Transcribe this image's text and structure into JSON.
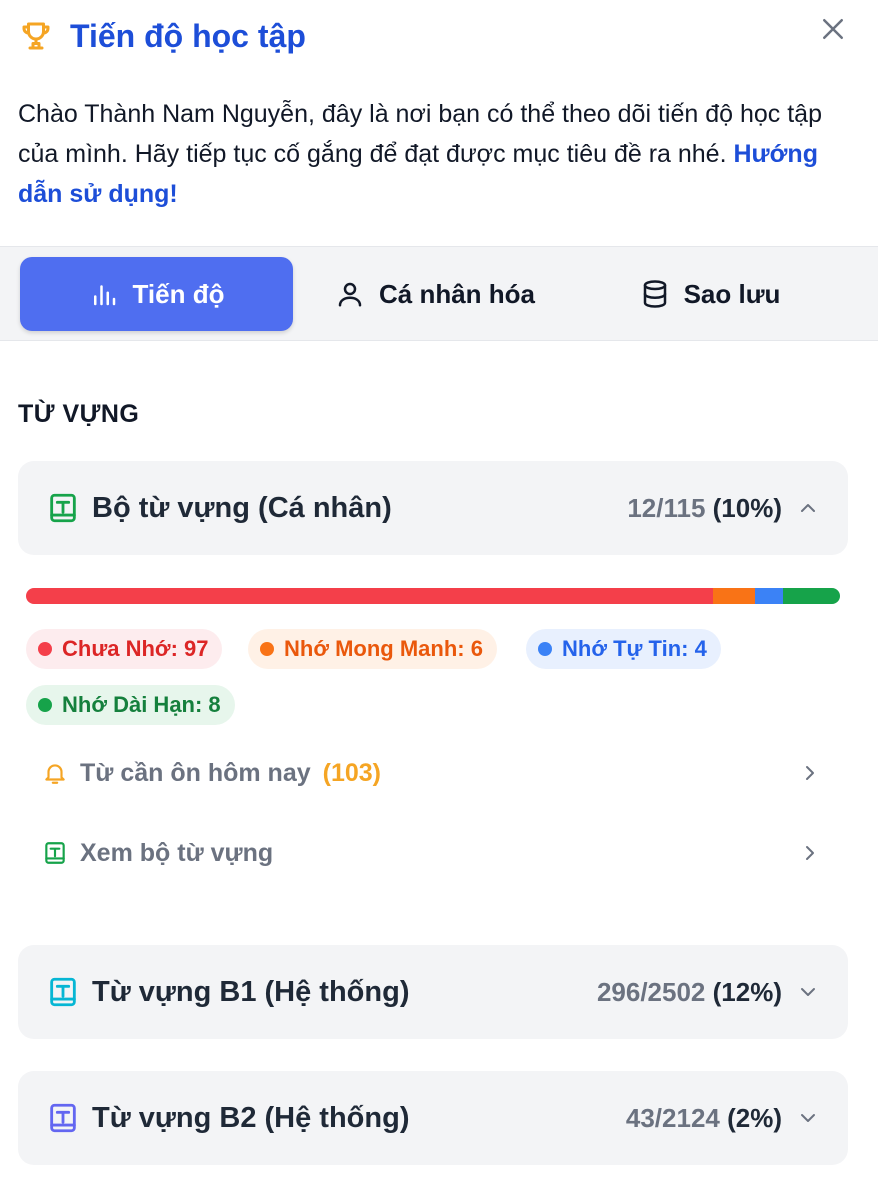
{
  "header": {
    "title": "Tiến độ học tập",
    "intro": "Chào Thành Nam Nguyễn, đây là nơi bạn có thể theo dõi tiến độ học tập của mình. Hãy tiếp tục cố gắng để đạt được mục tiêu đề ra nhé.",
    "guide_link": "Hướng dẫn sử dụng!"
  },
  "tabs": [
    {
      "label": "Tiến độ",
      "icon": "bar-chart-icon",
      "active": true
    },
    {
      "label": "Cá nhân hóa",
      "icon": "user-icon",
      "active": false
    },
    {
      "label": "Sao lưu",
      "icon": "database-icon",
      "active": false
    }
  ],
  "section_label": "TỪ VỰNG",
  "decks": [
    {
      "name": "Bộ từ vựng (Cá nhân)",
      "count": "12/115",
      "percent": "(10%)",
      "expanded": true,
      "icon_color": "#16a34a"
    },
    {
      "name": "Từ vựng B1 (Hệ thống)",
      "count": "296/2502",
      "percent": "(12%)",
      "expanded": false,
      "icon_color": "#06b6d4"
    },
    {
      "name": "Từ vựng B2 (Hệ thống)",
      "count": "43/2124",
      "percent": "(2%)",
      "expanded": false,
      "icon_color": "#6366f1"
    }
  ],
  "progress": {
    "total": 115,
    "segments": [
      {
        "label": "Chưa Nhớ: 97",
        "value": 97,
        "color": "#f43f4a",
        "text_color": "#dc2626",
        "bg": "#fdecee"
      },
      {
        "label": "Nhớ Mong Manh: 6",
        "value": 6,
        "color": "#f97316",
        "text_color": "#ea580c",
        "bg": "#fff1e6"
      },
      {
        "label": "Nhớ Tự Tin: 4",
        "value": 4,
        "color": "#3b82f6",
        "text_color": "#2563eb",
        "bg": "#e8f0fe"
      },
      {
        "label": "Nhớ Dài Hạn: 8",
        "value": 8,
        "color": "#16a34a",
        "text_color": "#15803d",
        "bg": "#e7f6ec"
      }
    ]
  },
  "rows": [
    {
      "label": "Từ cần ôn hôm nay",
      "count": "(103)",
      "icon": "bell-icon"
    },
    {
      "label": "Xem bộ từ vựng",
      "count": "",
      "icon": "book-icon"
    }
  ],
  "colors": {
    "accent": "#4f6ef0",
    "title": "#1d4ed8",
    "trophy": "#f5a524"
  }
}
